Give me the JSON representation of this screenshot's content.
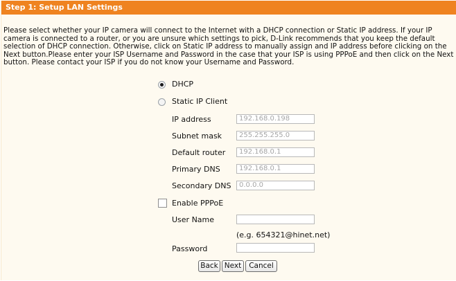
{
  "header": {
    "title": "Step 1: Setup LAN Settings"
  },
  "description": "Please select whether your IP camera will connect to the Internet with a DHCP connection or Static IP address. If your IP camera is connected to a router, or you are unsure which settings to pick, D-Link recommends that you keep the default selection of DHCP connection. Otherwise, click on Static IP address to manually assign and IP address before clicking on the Next button.Please enter your ISP Username and Password in the case that your ISP is using PPPoE and then click on the Next button. Please contact your ISP if you do not know your Username and Password.",
  "options": {
    "dhcp": {
      "label": "DHCP",
      "selected": true
    },
    "static": {
      "label": "Static IP Client",
      "selected": false
    }
  },
  "static_fields": {
    "ip_address": {
      "label": "IP address",
      "value": "192.168.0.198"
    },
    "subnet_mask": {
      "label": "Subnet mask",
      "value": "255.255.255.0"
    },
    "default_router": {
      "label": "Default router",
      "value": "192.168.0.1"
    },
    "primary_dns": {
      "label": "Primary DNS",
      "value": "192.168.0.1"
    },
    "secondary_dns": {
      "label": "Secondary DNS",
      "value": "0.0.0.0"
    }
  },
  "pppoe": {
    "label": "Enable PPPoE",
    "checked": false,
    "user_name_label": "User Name",
    "user_name_value": "",
    "example_hint": "(e.g. 654321@hinet.net)",
    "password_label": "Password",
    "password_value": ""
  },
  "buttons": {
    "back": "Back",
    "next": "Next",
    "cancel": "Cancel"
  }
}
